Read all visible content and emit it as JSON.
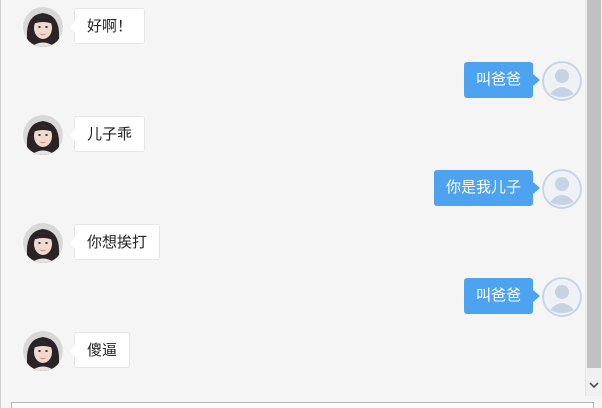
{
  "conversation": {
    "messages": [
      {
        "side": "left",
        "text": "好啊！",
        "avatar": "portrait-photo"
      },
      {
        "side": "right",
        "text": "叫爸爸",
        "avatar": "default-user-icon"
      },
      {
        "side": "left",
        "text": "儿子乖",
        "avatar": "portrait-photo"
      },
      {
        "side": "right",
        "text": "你是我儿子",
        "avatar": "default-user-icon"
      },
      {
        "side": "left",
        "text": "你想挨打",
        "avatar": "portrait-photo"
      },
      {
        "side": "right",
        "text": "叫爸爸",
        "avatar": "default-user-icon"
      },
      {
        "side": "left",
        "text": "傻逼",
        "avatar": "portrait-photo"
      }
    ]
  },
  "colors": {
    "sent_bubble": "#4da3ef",
    "received_bubble": "#ffffff",
    "background": "#f5f5f5"
  },
  "scrollbar": {
    "icon": "chevron-down-icon"
  }
}
